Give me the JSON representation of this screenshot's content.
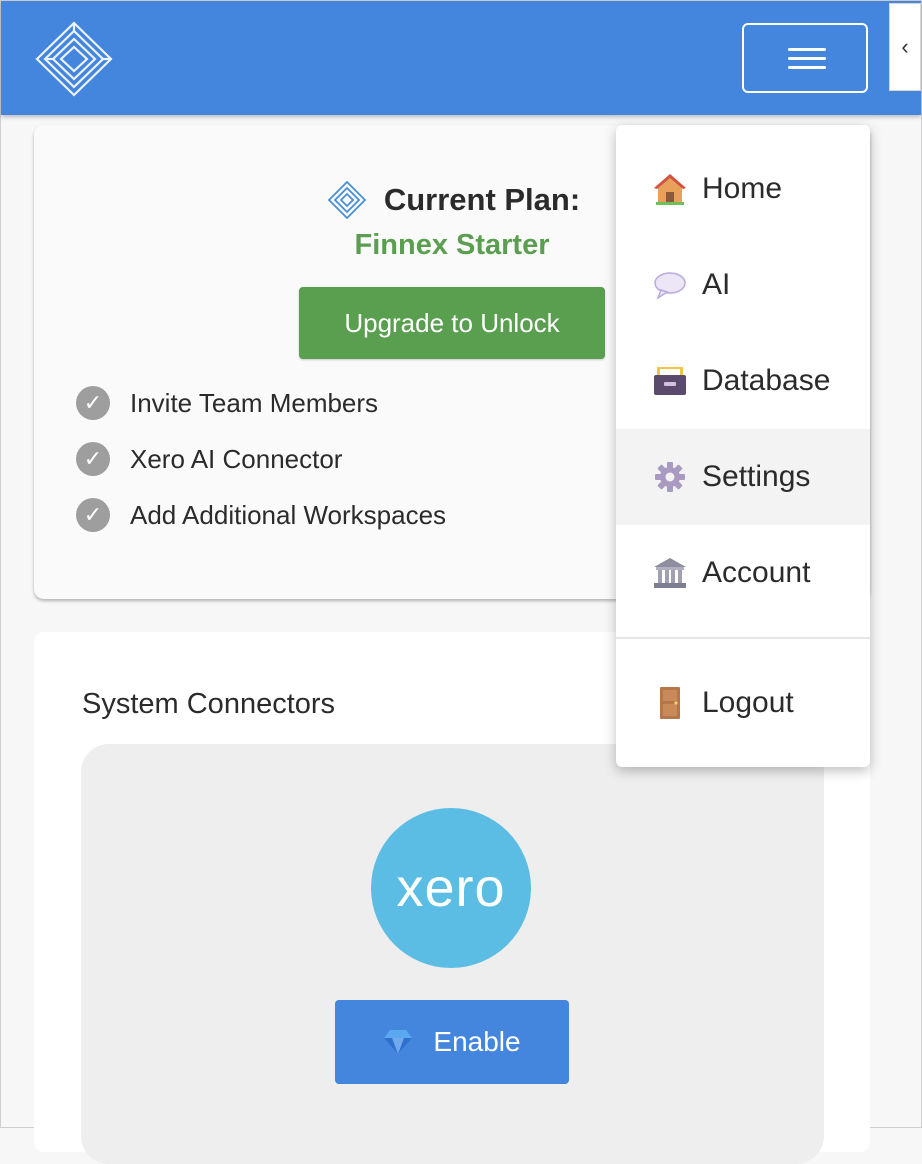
{
  "header": {
    "logo_icon": "maze-diamond-logo",
    "menu_icon": "hamburger-icon",
    "collapse_glyph": "‹",
    "brand_color": "#4485dd"
  },
  "plan": {
    "label": "Current Plan:",
    "name": "Finnex Starter",
    "upgrade_label": "Upgrade to Unlock",
    "features": [
      "Invite Team Members",
      "Xero AI Connector",
      "Add Additional Workspaces"
    ],
    "accent_color": "#5a9e4f"
  },
  "connectors": {
    "title": "System Connectors",
    "xero": {
      "logo_text": "xero",
      "enable_label": "Enable",
      "enable_icon": "gem-icon"
    }
  },
  "menu": {
    "items": [
      {
        "label": "Home",
        "icon": "house-icon"
      },
      {
        "label": "AI",
        "icon": "speech-bubble-icon"
      },
      {
        "label": "Database",
        "icon": "card-file-box-icon"
      },
      {
        "label": "Settings",
        "icon": "gear-icon",
        "active": true
      },
      {
        "label": "Account",
        "icon": "bank-icon"
      },
      {
        "label": "Logout",
        "icon": "door-icon"
      }
    ]
  }
}
